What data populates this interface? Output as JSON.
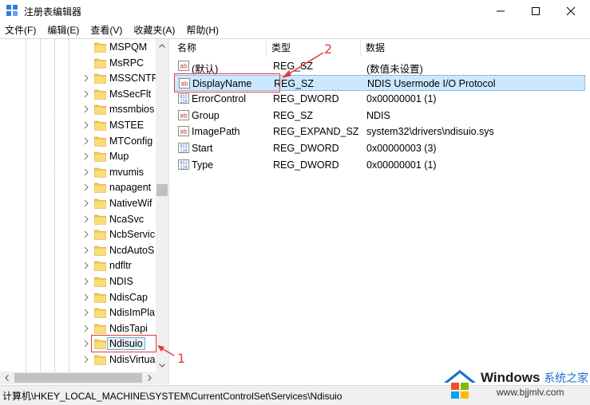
{
  "window": {
    "title": "注册表编辑器"
  },
  "menu": [
    "文件(F)",
    "编辑(E)",
    "查看(V)",
    "收藏夹(A)",
    "帮助(H)"
  ],
  "tree": {
    "items": [
      {
        "label": "MSPQM",
        "expandable": false
      },
      {
        "label": "MsRPC",
        "expandable": false
      },
      {
        "label": "MSSCNTR",
        "expandable": true
      },
      {
        "label": "MsSecFlt",
        "expandable": true
      },
      {
        "label": "mssmbios",
        "expandable": true
      },
      {
        "label": "MSTEE",
        "expandable": true
      },
      {
        "label": "MTConfig",
        "expandable": true
      },
      {
        "label": "Mup",
        "expandable": true
      },
      {
        "label": "mvumis",
        "expandable": true
      },
      {
        "label": "napagent",
        "expandable": true
      },
      {
        "label": "NativeWif",
        "expandable": true
      },
      {
        "label": "NcaSvc",
        "expandable": true
      },
      {
        "label": "NcbServic",
        "expandable": true
      },
      {
        "label": "NcdAutoS",
        "expandable": true
      },
      {
        "label": "ndfltr",
        "expandable": true
      },
      {
        "label": "NDIS",
        "expandable": true
      },
      {
        "label": "NdisCap",
        "expandable": true
      },
      {
        "label": "NdisImPla",
        "expandable": true
      },
      {
        "label": "NdisTapi",
        "expandable": true
      },
      {
        "label": "Ndisuio",
        "expandable": true,
        "selected": true
      },
      {
        "label": "NdisVirtua",
        "expandable": true
      }
    ]
  },
  "values": {
    "columns": [
      "名称",
      "类型",
      "数据"
    ],
    "rows": [
      {
        "name": "(默认)",
        "type": "REG_SZ",
        "data": "(数值未设置)",
        "icon": "string-value-icon"
      },
      {
        "name": "DisplayName",
        "type": "REG_SZ",
        "data": "NDIS Usermode I/O Protocol",
        "icon": "string-value-icon",
        "selected": true
      },
      {
        "name": "ErrorControl",
        "type": "REG_DWORD",
        "data": "0x00000001 (1)",
        "icon": "binary-value-icon"
      },
      {
        "name": "Group",
        "type": "REG_SZ",
        "data": "NDIS",
        "icon": "string-value-icon"
      },
      {
        "name": "ImagePath",
        "type": "REG_EXPAND_SZ",
        "data": "system32\\drivers\\ndisuio.sys",
        "icon": "string-value-icon"
      },
      {
        "name": "Start",
        "type": "REG_DWORD",
        "data": "0x00000003 (3)",
        "icon": "binary-value-icon"
      },
      {
        "name": "Type",
        "type": "REG_DWORD",
        "data": "0x00000001 (1)",
        "icon": "binary-value-icon"
      }
    ]
  },
  "status": {
    "path": "计算机\\HKEY_LOCAL_MACHINE\\SYSTEM\\CurrentControlSet\\Services\\Ndisuio"
  },
  "annotations": {
    "one": "1",
    "two": "2",
    "color": "#e53b3b"
  },
  "watermark": {
    "brand": "Windows",
    "brand_cn": "系统之家",
    "url": "www.bjjmlv.com"
  },
  "colors": {
    "selection": "#cce8ff",
    "folder": "#f5c955"
  }
}
